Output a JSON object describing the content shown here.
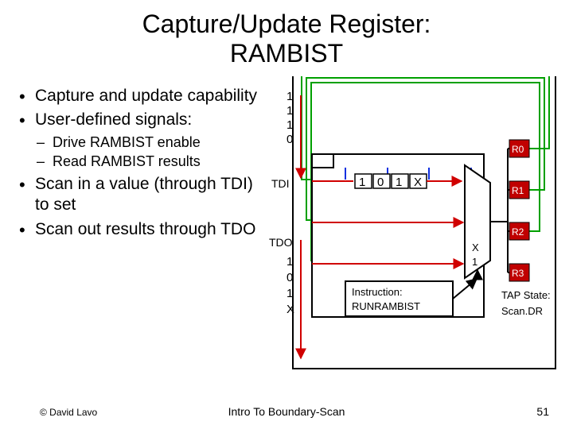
{
  "title_line1": "Capture/Update Register:",
  "title_line2": "RAMBIST",
  "bullets": {
    "b1": "Capture and update capability",
    "b2": "User-defined signals:",
    "b2a": "Drive RAMBIST enable",
    "b2b": "Read RAMBIST results",
    "b3": "Scan in a value (through TDI) to set",
    "b4": "Scan out results through TDO"
  },
  "diagram": {
    "top_bits": [
      "1",
      "1",
      "1",
      "0"
    ],
    "tdi_label": "TDI",
    "tdo_label": "TDO",
    "scan_in_bits": [
      "1",
      "0",
      "1",
      "X"
    ],
    "tdi_bits": [
      "1",
      "0",
      "1",
      "X"
    ],
    "mux_sel": [
      "X",
      "1"
    ],
    "instruction_label": "Instruction:",
    "instruction_value": "RUNRAMBIST",
    "tap_label": "TAP State:",
    "tap_value": "Scan.DR",
    "regs": {
      "r0": "R0",
      "r1": "R1",
      "r2": "R2",
      "r3": "R3"
    }
  },
  "footer": {
    "left": "© David Lavo",
    "center": "Intro To Boundary-Scan",
    "right": "51"
  }
}
